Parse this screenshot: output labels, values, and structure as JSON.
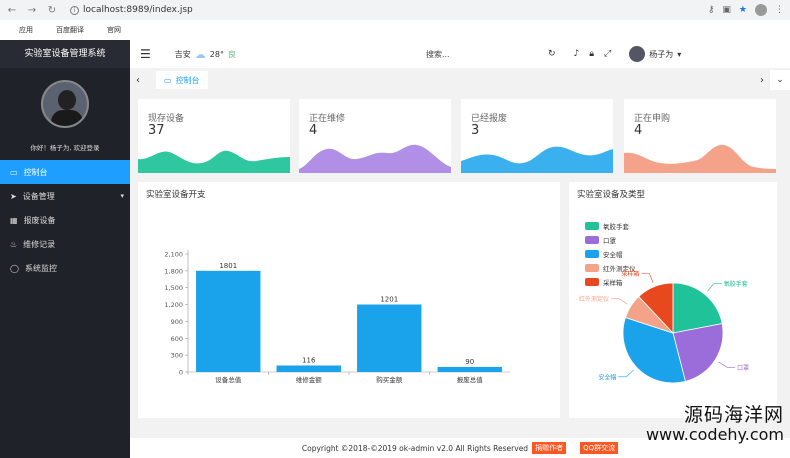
{
  "browser": {
    "url": "localhost:8989/index.jsp",
    "bookmarks": [
      {
        "label": "应用",
        "color": "#e44"
      },
      {
        "label": "百度翻译",
        "color": "#2b7de9"
      },
      {
        "label": "官网",
        "color": "#f4c542"
      }
    ]
  },
  "sidebar": {
    "title": "实验室设备管理系统",
    "welcome": "你好！杨子为, 欢迎登录",
    "items": [
      {
        "label": "控制台",
        "icon": "monitor-icon",
        "glyph": "▭"
      },
      {
        "label": "设备管理",
        "icon": "send-icon",
        "glyph": "➤"
      },
      {
        "label": "报废设备",
        "icon": "book-icon",
        "glyph": "▦"
      },
      {
        "label": "维修记录",
        "icon": "fire-icon",
        "glyph": "♨"
      },
      {
        "label": "系统监控",
        "icon": "circle-icon",
        "glyph": "◯"
      }
    ]
  },
  "header": {
    "city": "吉安",
    "temp": "28°",
    "aqi": "良",
    "search_placeholder": "搜索...",
    "user": "杨子为"
  },
  "tabs": {
    "active": "控制台"
  },
  "cards": [
    {
      "label": "现存设备",
      "value": "37",
      "color": "#2ec7a0"
    },
    {
      "label": "正在维修",
      "value": "4",
      "color": "#b28fe6"
    },
    {
      "label": "已经报废",
      "value": "3",
      "color": "#3bb0ef"
    },
    {
      "label": "正在申购",
      "value": "4",
      "color": "#f5a28a"
    }
  ],
  "bar_panel": {
    "title": "实验室设备开支"
  },
  "pie_panel": {
    "title": "实验室设备及类型"
  },
  "chart_data": [
    {
      "type": "bar",
      "categories": [
        "设备总值",
        "维修金额",
        "购买金额",
        "报废总值"
      ],
      "values": [
        1801,
        116,
        1201,
        90
      ],
      "yticks": [
        "0",
        "300",
        "600",
        "900",
        "1,200",
        "1,500",
        "1,800",
        "2,100"
      ],
      "ylim": [
        0,
        2100
      ],
      "color": "#1aa3ea"
    },
    {
      "type": "pie",
      "labels": [
        "氧胶手套",
        "口罩",
        "安全帽",
        "红外测定仪",
        "采样箱"
      ],
      "values": [
        22,
        24,
        34,
        8,
        12
      ],
      "colors": [
        "#20c29a",
        "#9b6ddb",
        "#1aa3ea",
        "#f5a28a",
        "#e8481e"
      ],
      "slice_labels": [
        "氧胶手套",
        "口罩",
        "安全帽",
        "红外测定仪",
        "采样箱"
      ],
      "legend": "top-left"
    }
  ],
  "footer": {
    "text": "Copyright ©2018-©2019 ok-admin v2.0 All Rights Reserved",
    "btn1": "捐赠作者",
    "btn2": "QQ群交流"
  },
  "watermark": {
    "cn": "源码海洋网",
    "url": "www.codehy.com"
  }
}
